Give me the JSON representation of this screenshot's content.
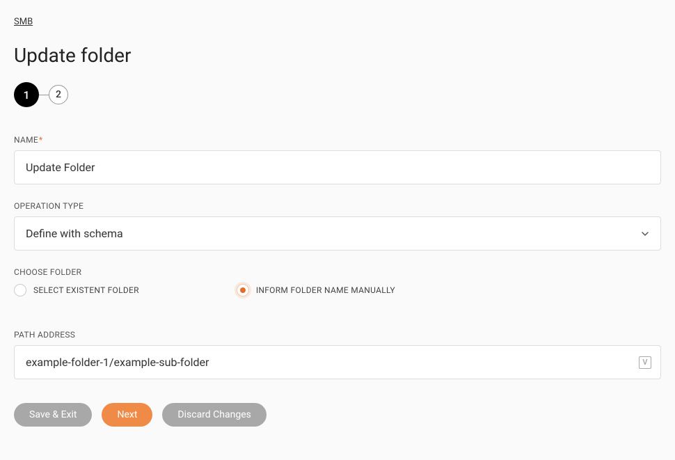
{
  "breadcrumb": "SMB",
  "page_title": "Update folder",
  "stepper": {
    "step1": "1",
    "step2": "2"
  },
  "fields": {
    "name": {
      "label": "NAME",
      "required_marker": "*",
      "value": "Update Folder"
    },
    "operation_type": {
      "label": "OPERATION TYPE",
      "value": "Define with schema"
    },
    "choose_folder": {
      "label": "CHOOSE FOLDER",
      "option1": "SELECT EXISTENT FOLDER",
      "option2": "INFORM FOLDER NAME MANUALLY"
    },
    "path_address": {
      "label": "PATH ADDRESS",
      "value": "example-folder-1/example-sub-folder",
      "icon_letter": "V"
    }
  },
  "buttons": {
    "save_exit": "Save & Exit",
    "next": "Next",
    "discard": "Discard Changes"
  }
}
